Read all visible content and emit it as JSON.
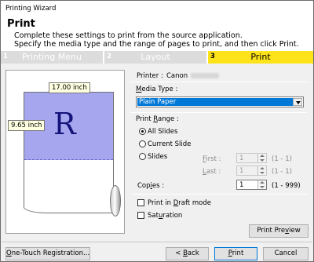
{
  "window": {
    "title": "Printing Wizard"
  },
  "header": {
    "title": "Print",
    "line1": "Complete these settings to print from the source application.",
    "line2": "Specify the media type and the range of pages to print, and then click Print."
  },
  "steps": [
    {
      "num": "1",
      "label": "Printing Menu"
    },
    {
      "num": "2",
      "label": "Layout"
    },
    {
      "num": "3",
      "label": "Print"
    }
  ],
  "preview": {
    "width_label": "17.00 inch",
    "height_label": "9.65 inch",
    "letter": "R"
  },
  "printer": {
    "label": "Printer :",
    "value": "Canon"
  },
  "media": {
    "label_pre": "M",
    "label_rest": "edia Type :",
    "selected": "Plain Paper"
  },
  "range": {
    "label_pre": "Print ",
    "label_u": "R",
    "label_rest": "ange :",
    "all": "All Slides",
    "current": "Current Slide",
    "slides": "Slides",
    "first_u": "F",
    "first_rest": "irst :",
    "first_value": "1",
    "first_range": "(1 - 1)",
    "last_u": "L",
    "last_rest": "ast :",
    "last_value": "1",
    "last_range": "(1 - 1)"
  },
  "copies": {
    "label_pre": "Cop",
    "label_u": "i",
    "label_rest": "es :",
    "value": "1",
    "range": "(1 - 999)"
  },
  "options": {
    "draft_pre": "Print in ",
    "draft_u": "D",
    "draft_rest": "raft mode",
    "sat_pre": "Sat",
    "sat_u": "u",
    "sat_rest": "ration"
  },
  "buttons": {
    "print_preview_pre": "Print Pre",
    "print_preview_u": "v",
    "print_preview_rest": "iew",
    "one_touch_pre": "",
    "one_touch_u": "O",
    "one_touch_rest": "ne-Touch Registration...",
    "back_pre": "< ",
    "back_u": "B",
    "back_rest": "ack",
    "print_pre": "",
    "print_u": "P",
    "print_rest": "rint",
    "cancel": "Cancel"
  }
}
